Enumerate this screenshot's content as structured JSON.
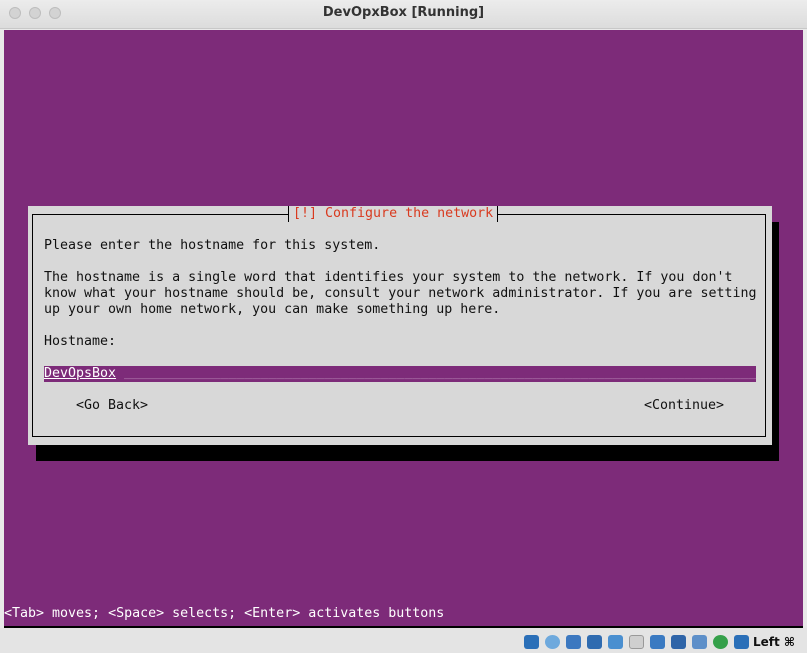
{
  "window": {
    "title": "DevOpxBox [Running]"
  },
  "dialog": {
    "title": "[!] Configure the network",
    "prompt": "Please enter the hostname for this system.",
    "description_lines": [
      "The hostname is a single word that identifies your system to the network. If you don't",
      "know what your hostname should be, consult your network administrator. If you are setting",
      "up your own home network, you can make something up here."
    ],
    "field_label": "Hostname:",
    "hostname_value": "DevOpsBox",
    "go_back_label": "<Go Back>",
    "continue_label": "<Continue>"
  },
  "footer": {
    "hint": "<Tab> moves; <Space> selects; <Enter> activates buttons"
  },
  "statusbar": {
    "host_key": "Left ⌘",
    "icons": [
      "hard-disk-icon",
      "optical-drive-icon",
      "audio-icon",
      "network-icon",
      "usb-icon",
      "shared-folders-icon",
      "display-icon",
      "video-capture-icon",
      "recording-icon",
      "virtualization-icon",
      "mouse-integration-icon",
      "download-icon"
    ],
    "colors": {
      "console_bg": "#7d2b79",
      "dialog_bg": "#d8d8d8",
      "dialog_title": "#d93a1f"
    }
  }
}
